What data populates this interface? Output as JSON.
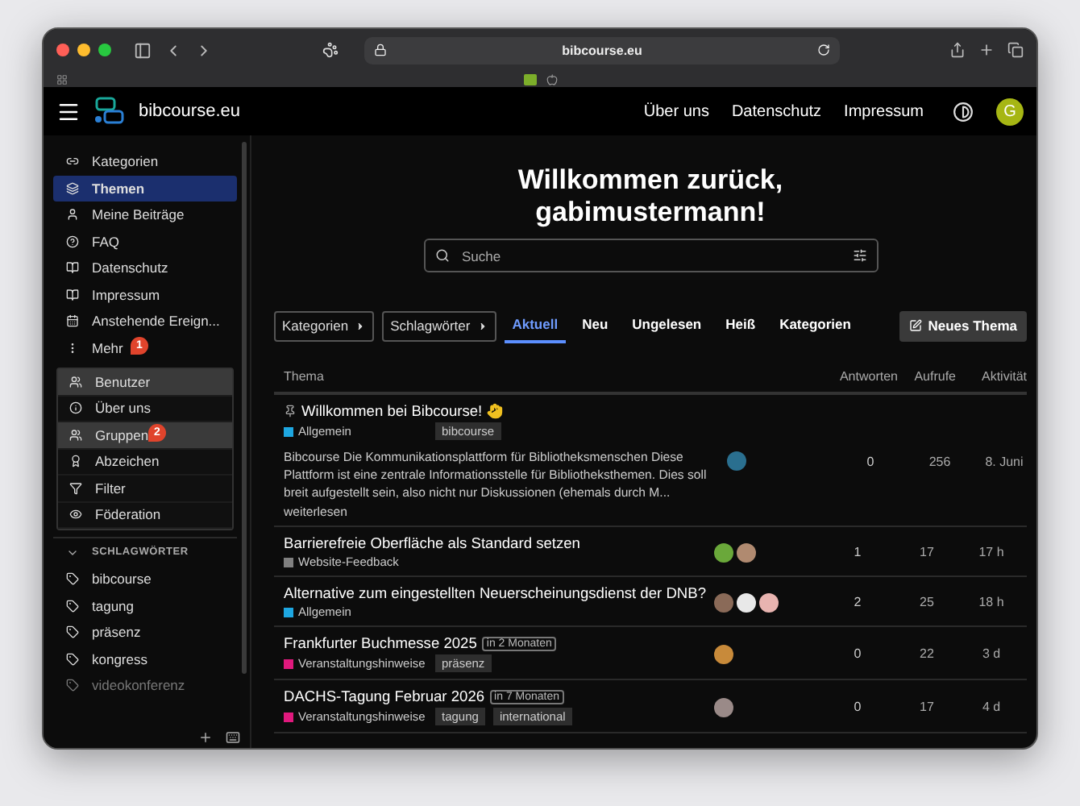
{
  "browser": {
    "url": "bibcourse.eu"
  },
  "header": {
    "site_name": "bibcourse.eu",
    "nav": [
      "Über uns",
      "Datenschutz",
      "Impressum"
    ],
    "avatar_letter": "G"
  },
  "sidebar": {
    "items": [
      {
        "label": "Kategorien",
        "selected": false
      },
      {
        "label": "Themen",
        "selected": true
      },
      {
        "label": "Meine Beiträge",
        "selected": false
      },
      {
        "label": "FAQ",
        "selected": false
      },
      {
        "label": "Datenschutz",
        "selected": false
      },
      {
        "label": "Impressum",
        "selected": false
      },
      {
        "label": "Anstehende Ereign...",
        "selected": false
      },
      {
        "label": "Mehr",
        "selected": false,
        "callout": "1"
      }
    ],
    "more_menu": [
      {
        "label": "Benutzer",
        "highlighted": true
      },
      {
        "label": "Über uns",
        "highlighted": false
      },
      {
        "label": "Gruppen",
        "highlighted": true,
        "callout": "2"
      },
      {
        "label": "Abzeichen",
        "highlighted": false
      },
      {
        "label": "Filter",
        "highlighted": false
      },
      {
        "label": "Föderation",
        "highlighted": false
      }
    ],
    "tags_section": {
      "title": "SCHLAGWÖRTER",
      "expanded": true,
      "tags": [
        {
          "label": "bibcourse",
          "faded": false
        },
        {
          "label": "tagung",
          "faded": false
        },
        {
          "label": "präsenz",
          "faded": false
        },
        {
          "label": "kongress",
          "faded": false
        },
        {
          "label": "videokonferenz",
          "faded": true
        }
      ]
    }
  },
  "main": {
    "welcome": [
      "Willkommen zurück,",
      "gabimustermann!"
    ],
    "search": {
      "placeholder": "Suche"
    },
    "filters": [
      "Kategorien",
      "Schlagwörter"
    ],
    "tabs": [
      {
        "label": "Aktuell",
        "selected": true
      },
      {
        "label": "Neu",
        "selected": false
      },
      {
        "label": "Ungelesen",
        "selected": false
      },
      {
        "label": "Heiß",
        "selected": false
      },
      {
        "label": "Kategorien",
        "selected": false
      }
    ],
    "new_topic_button": "Neues Thema",
    "table": {
      "columns": [
        "Thema",
        "Antworten",
        "Aufrufe",
        "Aktivität"
      ],
      "rows": [
        {
          "title": "Willkommen bei Bibcourse!",
          "pinned": true,
          "waving": true,
          "category": {
            "name": "Allgemein",
            "color": "#1ea7e1"
          },
          "tags": [
            "bibcourse"
          ],
          "excerpt": "Bibcourse Die Kommunikationsplattform für Bibliotheksmenschen Diese Plattform ist eine zentrale Informationsstelle für Bibliotheksthemen. Dies soll breit aufgestellt sein, also nicht nur Diskussionen (ehemals durch M...",
          "read_more": "weiterlesen",
          "posters": [
            {
              "color": "#2a6f8f"
            }
          ],
          "replies": "0",
          "views": "256",
          "activity": "8. Juni"
        },
        {
          "title": "Barrierefreie Oberfläche als Standard setzen",
          "pinned": false,
          "waving": false,
          "category": {
            "name": "Website-Feedback",
            "color": "#808080"
          },
          "tags": [],
          "posters": [
            {
              "color": "#6aa83a"
            },
            {
              "color": "#b08a70"
            }
          ],
          "replies": "1",
          "views": "17",
          "activity": "17 h"
        },
        {
          "title": "Alternative zum eingestellten Neuerscheinungsdienst der DNB?",
          "pinned": false,
          "waving": false,
          "category": {
            "name": "Allgemein",
            "color": "#1ea7e1"
          },
          "tags": [],
          "posters": [
            {
              "color": "#8a6a58"
            },
            {
              "color": "#e8e8e8"
            },
            {
              "color": "#e8b4b0"
            }
          ],
          "replies": "2",
          "views": "25",
          "activity": "18 h"
        },
        {
          "title": "Frankfurter Buchmesse 2025",
          "event": "in 2 Monaten",
          "pinned": false,
          "waving": false,
          "category": {
            "name": "Veranstaltungshinweise",
            "color": "#e0197d"
          },
          "tags": [
            "präsenz"
          ],
          "posters": [
            {
              "color": "#c88a3a"
            }
          ],
          "replies": "0",
          "views": "22",
          "activity": "3 d"
        },
        {
          "title": "DACHS-Tagung Februar 2026",
          "event": "in 7 Monaten",
          "pinned": false,
          "waving": false,
          "category": {
            "name": "Veranstaltungshinweise",
            "color": "#e0197d"
          },
          "tags": [
            "tagung",
            "international"
          ],
          "posters": [
            {
              "color": "#9a8a88"
            }
          ],
          "replies": "0",
          "views": "17",
          "activity": "4 d"
        }
      ]
    }
  }
}
